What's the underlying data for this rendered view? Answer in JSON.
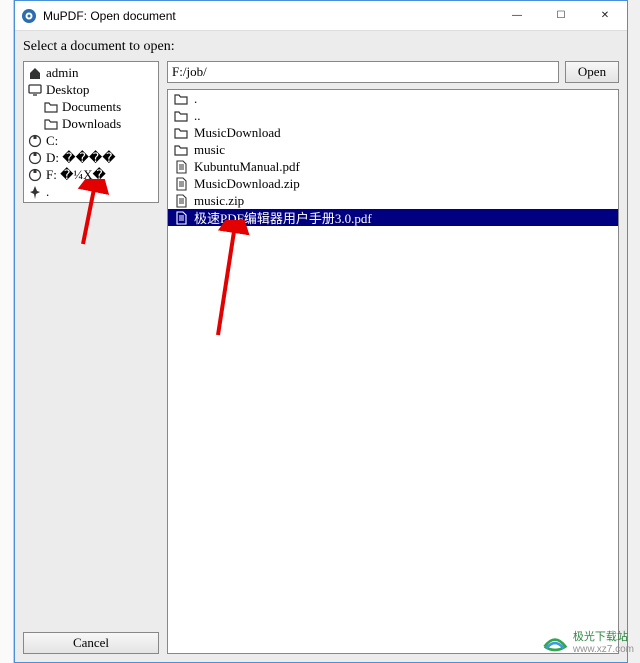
{
  "window": {
    "title": "MuPDF: Open document",
    "minimize": "—",
    "maximize": "☐",
    "close": "✕"
  },
  "prompt": "Select a document to open:",
  "path_value": "F:/job/",
  "open_label": "Open",
  "cancel_label": "Cancel",
  "tree": [
    {
      "icon": "home",
      "label": "admin",
      "indent": false
    },
    {
      "icon": "desktop",
      "label": "Desktop",
      "indent": false
    },
    {
      "icon": "folder",
      "label": "Documents",
      "indent": true
    },
    {
      "icon": "folder",
      "label": "Downloads",
      "indent": true
    },
    {
      "icon": "disk",
      "label": "C:",
      "indent": false
    },
    {
      "icon": "disk",
      "label": "D: ����",
      "indent": false
    },
    {
      "icon": "disk",
      "label": "F: �¼X�",
      "indent": false
    },
    {
      "icon": "pin",
      "label": ".",
      "indent": false
    }
  ],
  "files": [
    {
      "icon": "folder",
      "label": ".",
      "selected": false
    },
    {
      "icon": "folder",
      "label": "..",
      "selected": false
    },
    {
      "icon": "folder",
      "label": "MusicDownload",
      "selected": false
    },
    {
      "icon": "folder",
      "label": "music",
      "selected": false
    },
    {
      "icon": "file",
      "label": "KubuntuManual.pdf",
      "selected": false
    },
    {
      "icon": "file",
      "label": "MusicDownload.zip",
      "selected": false
    },
    {
      "icon": "file",
      "label": "music.zip",
      "selected": false
    },
    {
      "icon": "file",
      "label": "极速PDF编辑器用户手册3.0.pdf",
      "selected": true
    }
  ],
  "watermark": {
    "name": "极光下载站",
    "url": "www.xz7.com"
  }
}
